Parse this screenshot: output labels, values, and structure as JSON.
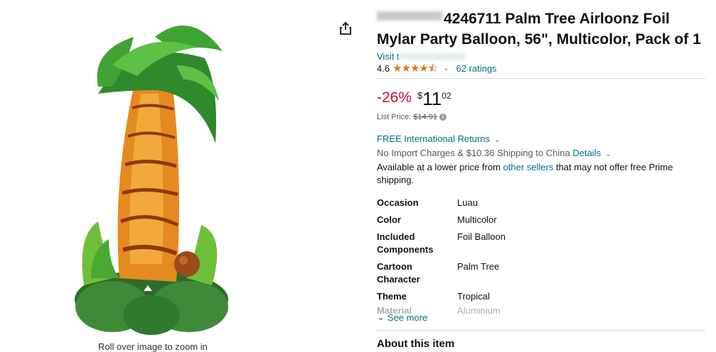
{
  "image": {
    "zoom_hint": "Roll over image to zoom in",
    "icon": "palm-tree-balloon-image"
  },
  "share": {
    "icon": "share-icon"
  },
  "product": {
    "title_suffix": "4246711 Palm Tree Airloonz Foil Mylar Party Balloon, 56\", Multicolor, Pack of 1",
    "visit_prefix": "Visit t",
    "rating_value": "4.6",
    "stars": "★★★★⯪",
    "ratings_link": "62 ratings"
  },
  "price": {
    "discount": "-26%",
    "currency": "$",
    "whole": "11",
    "fraction": "02",
    "list_label": "List Price:",
    "list_value": "$14.91"
  },
  "shipping": {
    "returns": "FREE International Returns",
    "import_text": "No Import Charges & $10.36 Shipping to China",
    "details_link": "Details",
    "avail_prefix": "Available at a lower price from",
    "avail_link": "other sellers",
    "avail_suffix": "that may not offer free Prime shipping."
  },
  "attributes": [
    {
      "key": "Occasion",
      "value": "Luau"
    },
    {
      "key": "Color",
      "value": "Multicolor"
    },
    {
      "key": "Included Components",
      "value": "Foil Balloon"
    },
    {
      "key": "Cartoon Character",
      "value": "Palm Tree"
    },
    {
      "key": "Theme",
      "value": "Tropical"
    },
    {
      "key": "Material",
      "value": "Aluminium"
    }
  ],
  "see_more": "See more",
  "about": "About this item",
  "colors": {
    "link": "#007185",
    "discount": "#cc0c39",
    "star": "#de7921"
  }
}
